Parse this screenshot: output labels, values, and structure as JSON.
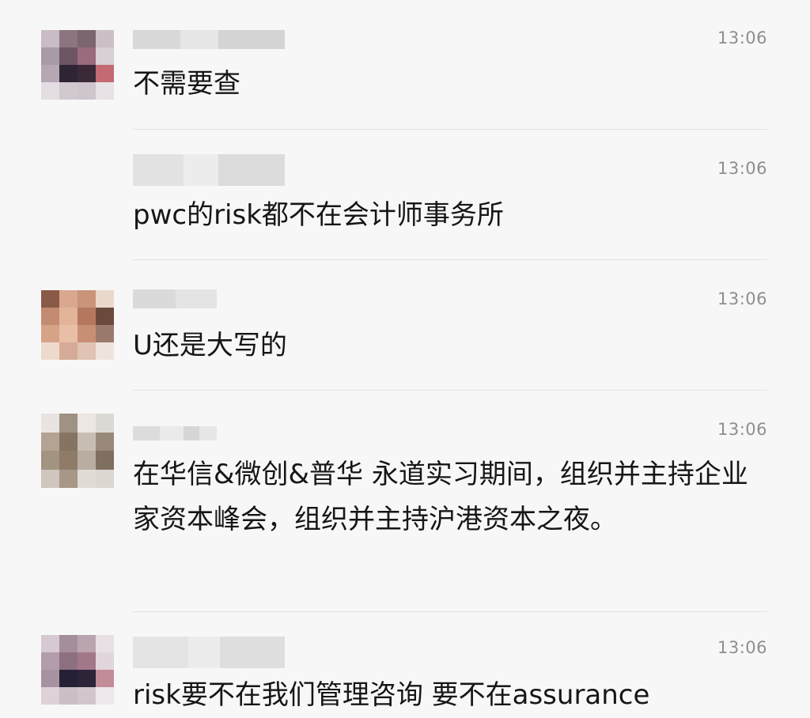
{
  "messages": [
    {
      "time": "13:06",
      "text": "不需要查"
    },
    {
      "time": "13:06",
      "text": "pwc的risk都不在会计师事务所"
    },
    {
      "time": "13:06",
      "text": "U还是大写的"
    },
    {
      "time": "13:06",
      "text": "在华信&微创&普华 永道实习期间，组织并主持企业家资本峰会，组织并主持沪港资本之夜。"
    },
    {
      "time": "13:06",
      "text": "risk要不在我们管理咨询 要不在assurance"
    }
  ]
}
